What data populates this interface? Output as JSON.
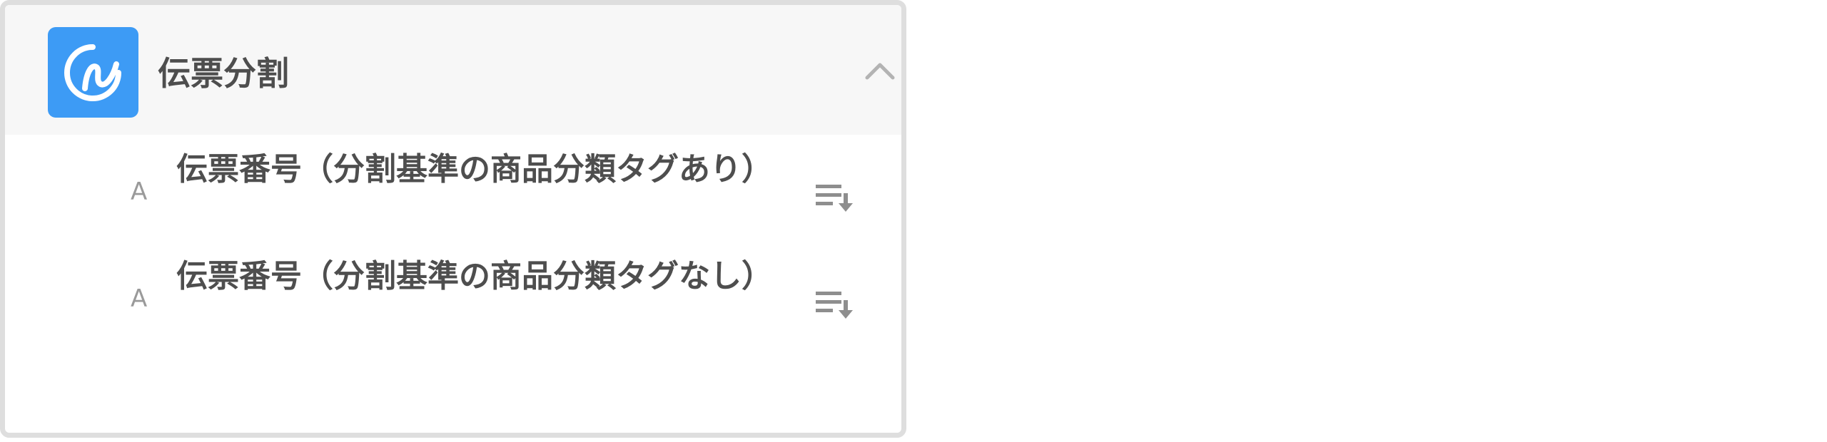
{
  "panel": {
    "title": "伝票分割",
    "logo_icon": "app-logo-icon",
    "collapse_icon": "chevron-up-icon",
    "accent_color": "#3d9bf5"
  },
  "fields": [
    {
      "type_icon_text": "A",
      "label": "伝票番号（分割基準の商品分類タグあり）",
      "action_icon": "sort-descending-icon"
    },
    {
      "type_icon_text": "A",
      "label": "伝票番号（分割基準の商品分類タグなし）",
      "action_icon": "sort-descending-icon"
    }
  ]
}
